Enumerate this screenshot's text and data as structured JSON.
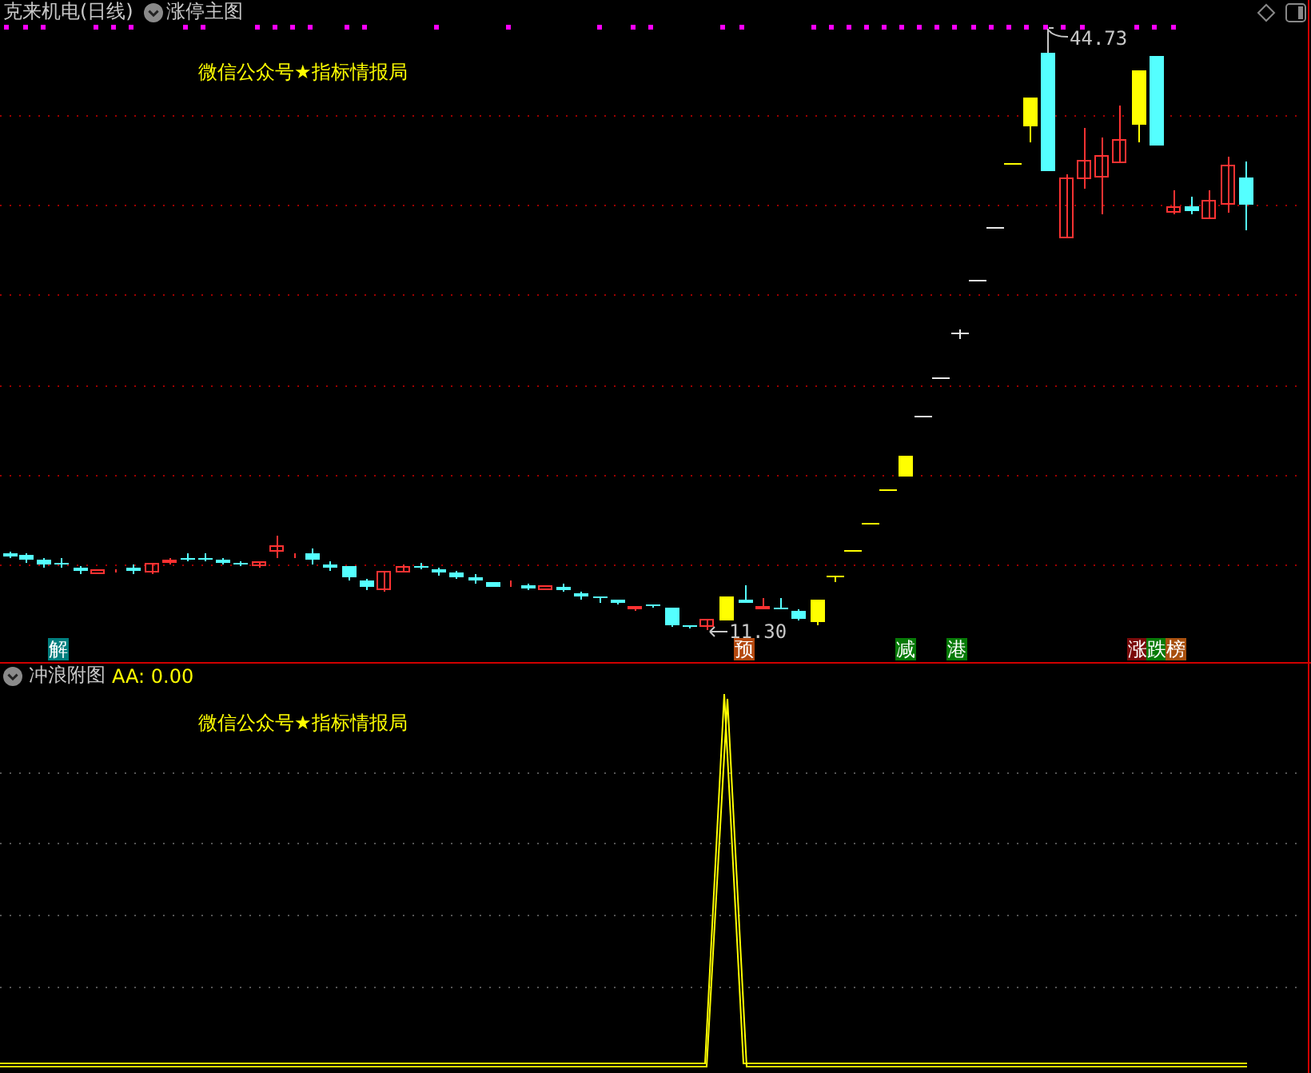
{
  "main_chart": {
    "title": "克来机电(日线)",
    "indicator": "涨停主图",
    "note": "微信公众号★指标情报局",
    "price_labels": [
      {
        "kind": "high",
        "text": "44.73"
      },
      {
        "kind": "low",
        "text": "11.30"
      }
    ],
    "signal_tags": [
      {
        "text": "解",
        "color": "#007f7f"
      },
      {
        "text": "预",
        "color": "#b4480e"
      },
      {
        "text": "减",
        "color": "#067a06"
      },
      {
        "text": "港",
        "color": "#067a06"
      },
      {
        "text": "涨",
        "color": "#7a0a0a"
      },
      {
        "text": "跌",
        "color": "#067a06"
      },
      {
        "text": "榜",
        "color": "#a8500e"
      }
    ]
  },
  "sub_chart": {
    "title": "冲浪附图",
    "reading": "AA: 0.00",
    "note": "微信公众号★指标情报局"
  }
}
